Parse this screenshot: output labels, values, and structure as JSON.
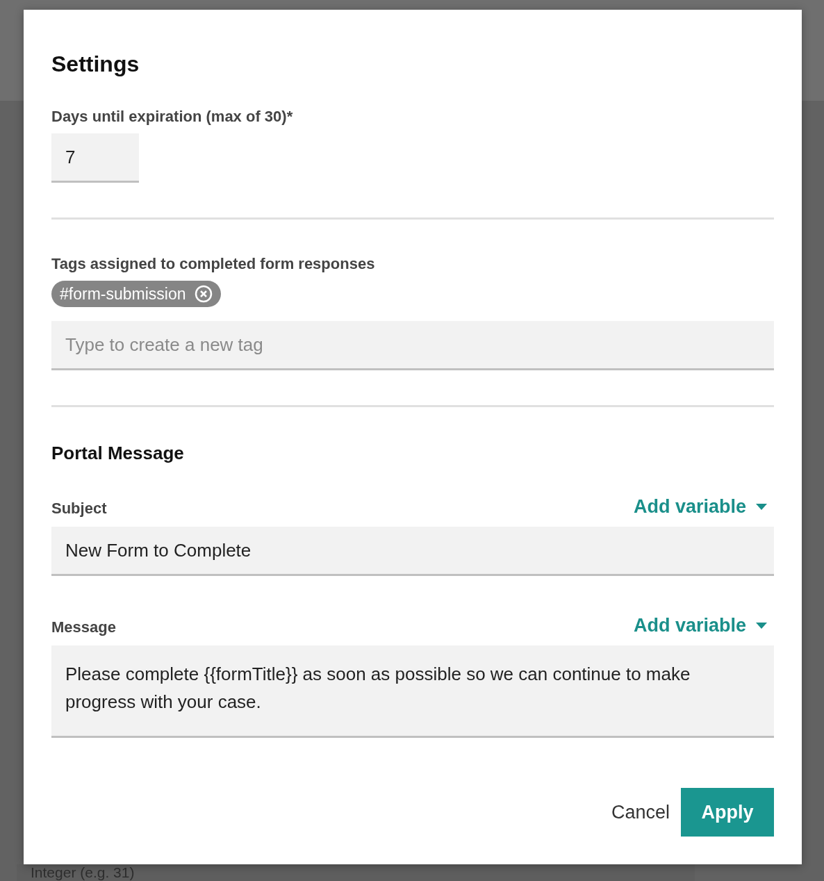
{
  "dialog": {
    "title": "Settings",
    "expiration": {
      "label": "Days until expiration (max of 30)*",
      "value": "7"
    },
    "tags": {
      "label": "Tags assigned to completed form responses",
      "items": [
        {
          "label": "#form-submission"
        }
      ],
      "placeholder": "Type to create a new tag"
    },
    "portal_message": {
      "heading": "Portal Message",
      "subject": {
        "label": "Subject",
        "add_variable": "Add variable",
        "value": "New Form to Complete"
      },
      "message": {
        "label": "Message",
        "add_variable": "Add variable",
        "value": "Please complete {{formTitle}} as soon as possible so we can continue to make progress with your case."
      }
    },
    "buttons": [
      {
        "label": "Cancel",
        "kind": "secondary"
      },
      {
        "label": "Apply",
        "kind": "primary"
      }
    ]
  },
  "background": {
    "field_placeholder": "Integer (e.g. 31)"
  }
}
